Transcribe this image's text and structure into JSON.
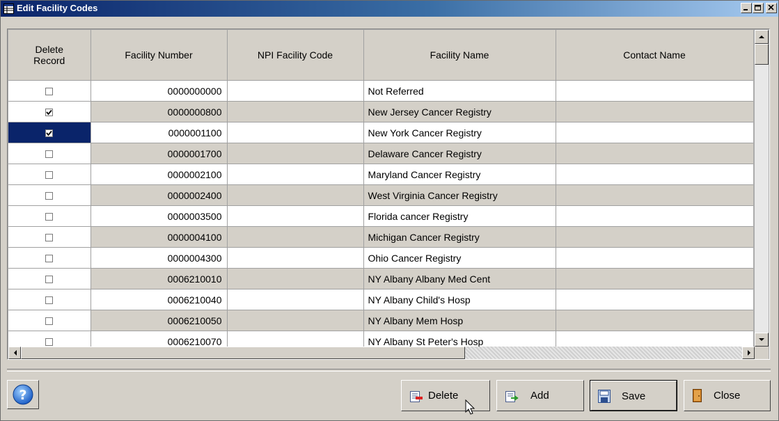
{
  "window": {
    "title": "Edit Facility Codes"
  },
  "grid": {
    "columns": {
      "delete": [
        "Delete",
        "Record"
      ],
      "facility_number": "Facility Number",
      "npi": "NPI Facility Code",
      "facility_name": "Facility Name",
      "contact_name": "Contact Name"
    },
    "rows": [
      {
        "checked": false,
        "facility_number": "0000000000",
        "npi": "",
        "facility_name": "Not Referred",
        "contact_name": ""
      },
      {
        "checked": true,
        "facility_number": "0000000800",
        "npi": "",
        "facility_name": "New Jersey Cancer Registry",
        "contact_name": ""
      },
      {
        "checked": true,
        "facility_number": "0000001100",
        "npi": "",
        "facility_name": "New York Cancer Registry",
        "contact_name": "",
        "selected": true
      },
      {
        "checked": false,
        "facility_number": "0000001700",
        "npi": "",
        "facility_name": "Delaware Cancer Registry",
        "contact_name": ""
      },
      {
        "checked": false,
        "facility_number": "0000002100",
        "npi": "",
        "facility_name": "Maryland Cancer Registry",
        "contact_name": ""
      },
      {
        "checked": false,
        "facility_number": "0000002400",
        "npi": "",
        "facility_name": "West Virginia Cancer Registry",
        "contact_name": ""
      },
      {
        "checked": false,
        "facility_number": "0000003500",
        "npi": "",
        "facility_name": "Florida cancer Registry",
        "contact_name": ""
      },
      {
        "checked": false,
        "facility_number": "0000004100",
        "npi": "",
        "facility_name": "Michigan Cancer Registry",
        "contact_name": ""
      },
      {
        "checked": false,
        "facility_number": "0000004300",
        "npi": "",
        "facility_name": "Ohio Cancer Registry",
        "contact_name": ""
      },
      {
        "checked": false,
        "facility_number": "0006210010",
        "npi": "",
        "facility_name": "NY Albany Albany Med Cent",
        "contact_name": ""
      },
      {
        "checked": false,
        "facility_number": "0006210040",
        "npi": "",
        "facility_name": "NY Albany Child's Hosp",
        "contact_name": ""
      },
      {
        "checked": false,
        "facility_number": "0006210050",
        "npi": "",
        "facility_name": "NY Albany Mem Hosp",
        "contact_name": ""
      },
      {
        "checked": false,
        "facility_number": "0006210070",
        "npi": "",
        "facility_name": "NY Albany St Peter's Hosp",
        "contact_name": ""
      }
    ]
  },
  "buttons": {
    "delete": "Delete",
    "add": "Add",
    "save": "Save",
    "close": "Close"
  },
  "icons": {
    "help": "help-icon",
    "delete": "delete-record-icon",
    "add": "add-record-icon",
    "save": "save-icon",
    "close": "close-door-icon"
  }
}
